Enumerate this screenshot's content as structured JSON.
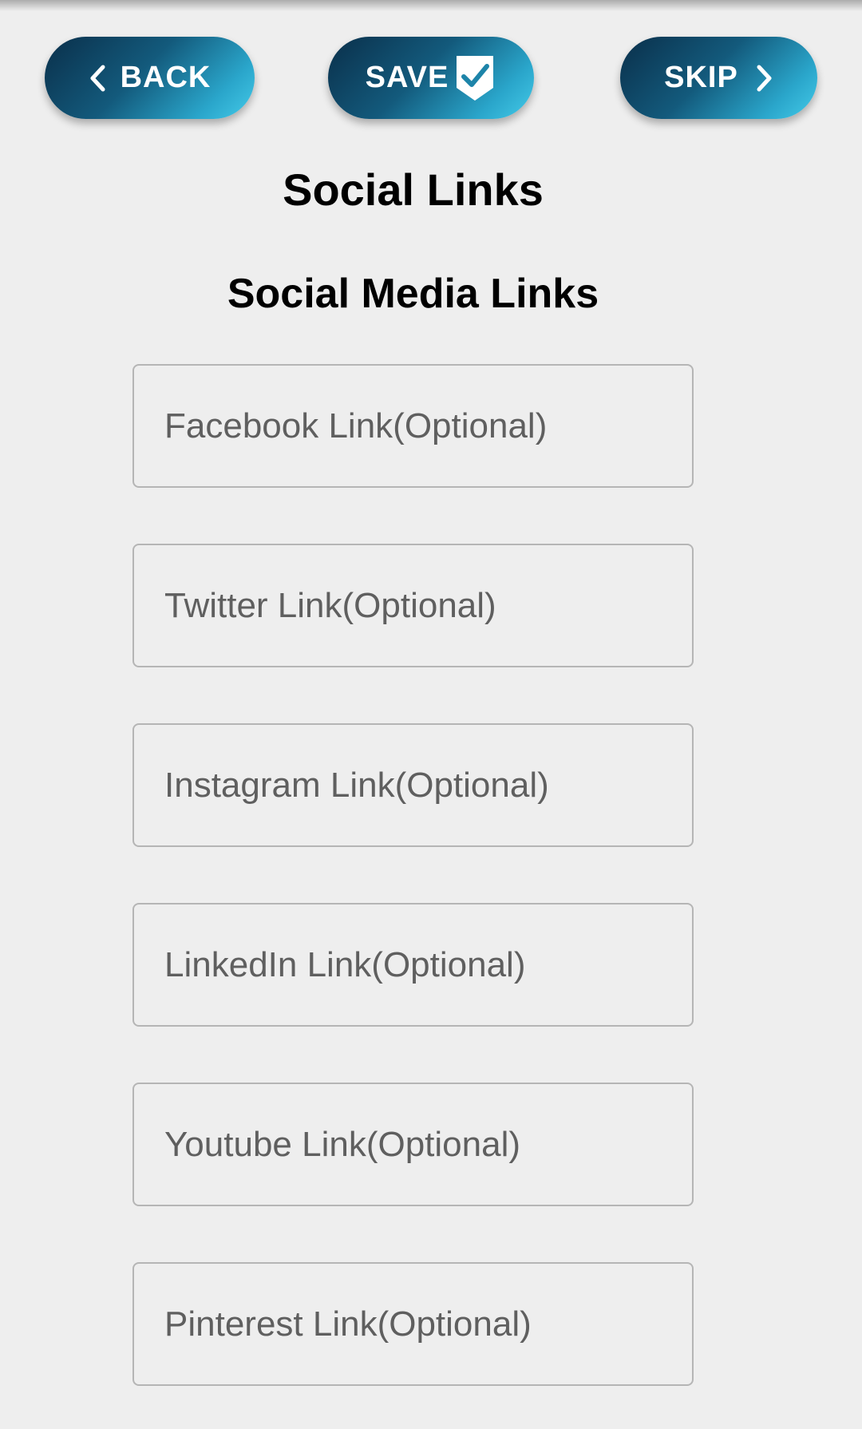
{
  "header": {
    "back_label": "BACK",
    "save_label": "SAVE",
    "skip_label": "SKIP",
    "back_icon": "chevron-left-icon",
    "save_icon": "shield-check-icon",
    "skip_icon": "chevron-right-icon"
  },
  "page": {
    "title": "Social Links",
    "section_title": "Social Media Links"
  },
  "fields": {
    "facebook": {
      "placeholder": "Facebook Link(Optional)",
      "value": ""
    },
    "twitter": {
      "placeholder": "Twitter Link(Optional)",
      "value": ""
    },
    "instagram": {
      "placeholder": "Instagram Link(Optional)",
      "value": ""
    },
    "linkedin": {
      "placeholder": "LinkedIn Link(Optional)",
      "value": ""
    },
    "youtube": {
      "placeholder": "Youtube Link(Optional)",
      "value": ""
    },
    "pinterest": {
      "placeholder": "Pinterest Link(Optional)",
      "value": ""
    }
  },
  "colors": {
    "background": "#eeeeee",
    "button_gradient_start": "#0a2f4a",
    "button_gradient_end": "#45cbe9",
    "button_text": "#ffffff",
    "field_border": "#b5b5b5",
    "placeholder_text": "#5f5f5f"
  }
}
